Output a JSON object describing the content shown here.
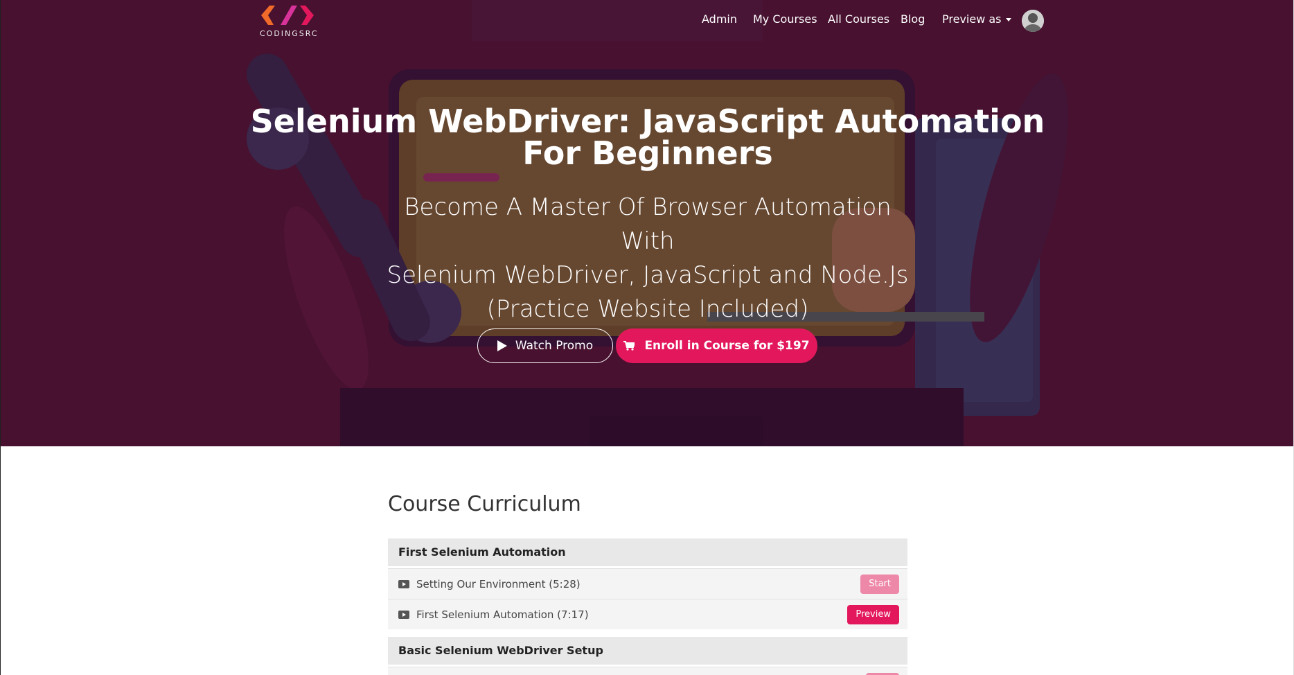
{
  "brand": {
    "logo_text": "CODINGSRC"
  },
  "nav": {
    "items": [
      "Admin",
      "My Courses",
      "All Courses",
      "Blog"
    ],
    "preview_label": "Preview as",
    "avatar_icon": "user-avatar"
  },
  "hero": {
    "title_line1": "Selenium WebDriver: JavaScript Automation",
    "title_line2": "For Beginners",
    "subtitle_line1": "Become A Master Of Browser Automation With",
    "subtitle_line2": "Selenium WebDriver, JavaScript and Node.Js",
    "subtitle_line3": "(Practice Website Included)",
    "promo_label": "Watch Promo",
    "enroll_label": "Enroll in Course for $197"
  },
  "colors": {
    "accent": "#e3185c",
    "hero_bg": "#4a1430"
  },
  "curriculum": {
    "title": "Course Curriculum",
    "sections": [
      {
        "title": "First Selenium Automation",
        "lectures": [
          {
            "label": "Setting Our Environment (5:28)",
            "action": "Start"
          },
          {
            "label": "First Selenium Automation (7:17)",
            "action": "Preview"
          }
        ]
      },
      {
        "title": "Basic Selenium WebDriver Setup"
      }
    ]
  }
}
